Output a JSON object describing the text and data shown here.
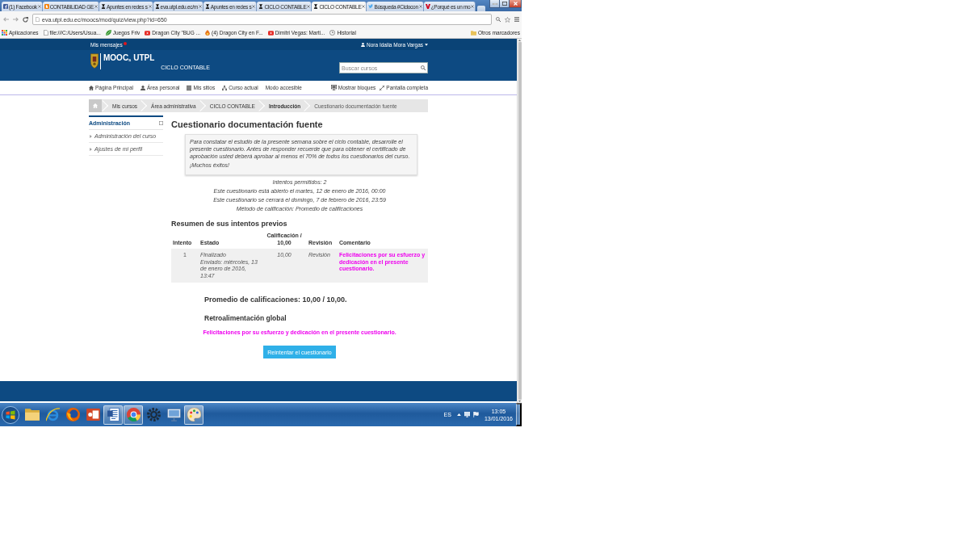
{
  "browser": {
    "tabs": [
      {
        "title": "(1) Facebook",
        "kind": "facebook",
        "selected": false
      },
      {
        "title": "CONTABILIDAD GE",
        "kind": "blog",
        "selected": false
      },
      {
        "title": "Apuntes en redes s",
        "kind": "moodle",
        "selected": false
      },
      {
        "title": "eva.utpl.edu.ec/m",
        "kind": "moodle",
        "selected": false
      },
      {
        "title": "Apuntes en redes s",
        "kind": "moodle",
        "selected": false
      },
      {
        "title": "CICLO CONTABLE",
        "kind": "moodle",
        "selected": false
      },
      {
        "title": "CICLO CONTABLE",
        "kind": "moodle",
        "selected": true
      },
      {
        "title": "Búsqueda #Ciclocon",
        "kind": "twitter",
        "selected": false
      },
      {
        "title": "¿Porqué es un mo",
        "kind": "v",
        "selected": false
      }
    ],
    "address": "eva.utpl.edu.ec/moocs/mod/quiz/view.php?id=650",
    "bookmarks": [
      {
        "label": "Aplicaciones",
        "kind": "apps"
      },
      {
        "label": "file:///C:/Users/Usua...",
        "kind": "file"
      },
      {
        "label": "Juegos Friv",
        "kind": "leaf"
      },
      {
        "label": "Dragon City \"BUG ...",
        "kind": "video"
      },
      {
        "label": "(4) Dragon City en F...",
        "kind": "flame"
      },
      {
        "label": "Dimitri Vegas: Marti...",
        "kind": "video"
      },
      {
        "label": "Historial",
        "kind": "history"
      }
    ],
    "other_bookmarks": "Otros marcadores"
  },
  "site": {
    "messages": "Mis mensajes",
    "user": "Nora Idalia Mora Vargas",
    "logo": "MOOC$_{s}$ UTPL",
    "course": "CICLO CONTABLE",
    "search": {
      "placeholder": "Buscar cursos"
    },
    "nav": [
      {
        "label": "Página Principal",
        "kind": "home"
      },
      {
        "label": "Área personal",
        "kind": "user"
      },
      {
        "label": "Mis sitios",
        "kind": "stack"
      },
      {
        "label": "Curso actual",
        "kind": "sitemap"
      },
      {
        "label": "Modo accesible",
        "kind": "text"
      }
    ],
    "nav_right": [
      {
        "label": "Mostrar bloques",
        "kind": "blocks"
      },
      {
        "label": "Pantalla completa",
        "kind": "expand"
      }
    ],
    "breadcrumb": [
      "Mis cursos",
      "Área administrativa",
      "CICLO CONTABLE",
      "Introducción",
      "Cuestionario documentación fuente"
    ]
  },
  "sidebar": {
    "title": "Administración",
    "items": [
      "Administración del curso",
      "Ajustes de mi perfil"
    ]
  },
  "quiz": {
    "title": "Cuestionario documentación fuente",
    "intro": [
      "Para constatar el estudio de la presente semana sobre el ciclo contable, desarrolle el presente cuestionario. Antes de responder recuerde que para obtener el certificado de aprobación usted deberá aprobar al menos el 70% de todos los cuestionarios del curso.",
      "¡Muchos éxitos!"
    ],
    "info": [
      "Intentos permitidos: 2",
      "Este cuestionario está abierto el martes, 12 de enero de 2016, 00:00",
      "Este cuestionario se cerrará el domingo, 7 de febrero de 2016, 23:59",
      "Método de calificación: Promedio de calificaciones"
    ],
    "summary_title": "Resumen de sus intentos previos",
    "table": {
      "columns": [
        "Intento",
        "Estado",
        "Calificación / 10,00",
        "Revisión",
        "Comentario"
      ],
      "rows": [
        {
          "attempt": "1",
          "state": "Finalizado",
          "submitted": "Enviado: miércoles, 13 de enero de 2016, 13:47",
          "grade": "10,00",
          "review": "Revisión",
          "comment": "Felicitaciones por su esfuerzo y dedicación en el presente cuestionario."
        }
      ]
    },
    "average": "Promedio de calificaciones: 10,00 / 10,00.",
    "feedback_title": "Retroalimentación global",
    "feedback": "Felicitaciones por su esfuerzo y dedicación en el presente cuestionario.",
    "button": "Reintentar el cuestionario"
  },
  "taskbar": {
    "apps": [
      {
        "kind": "folder",
        "open": false
      },
      {
        "kind": "ie",
        "open": false
      },
      {
        "kind": "firefox",
        "open": false
      },
      {
        "kind": "slides",
        "open": false
      },
      {
        "kind": "document",
        "open": true
      },
      {
        "kind": "chrome",
        "open": true
      },
      {
        "kind": "gear",
        "open": false
      },
      {
        "kind": "monitor",
        "open": false
      },
      {
        "kind": "paint",
        "open": true
      }
    ],
    "language": "ES",
    "time": "13:05",
    "date": "13/01/2016"
  }
}
